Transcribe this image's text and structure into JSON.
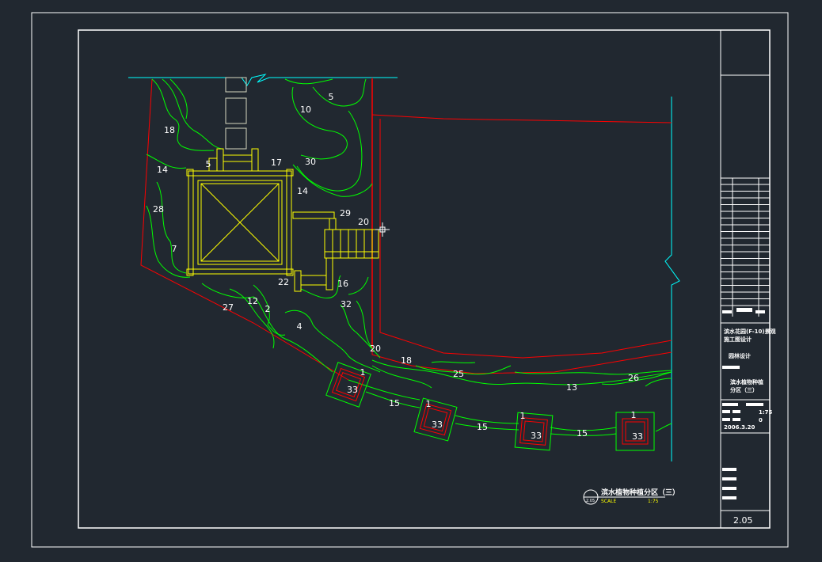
{
  "title_block": {
    "project_name_line1": "滨水花园(F-10)景观",
    "project_name_line2": "施工图设计",
    "discipline": "园林设计",
    "drawing_title_line1": "滨水植物种植",
    "drawing_title_line2": "分区（三）",
    "scale_value": "1:75",
    "revision": "0",
    "date": "2006.3.20",
    "sheet_number": "2.05"
  },
  "drawing_caption": {
    "title": "滨水植物种植分区（三）",
    "ref": "2.05",
    "scale_word": "SCALE",
    "scale_value": "1:75"
  },
  "zones": [
    "5",
    "10",
    "18",
    "14",
    "5",
    "17",
    "30",
    "14",
    "28",
    "29",
    "20",
    "7",
    "22",
    "16",
    "27",
    "12",
    "2",
    "32",
    "4",
    "20",
    "18",
    "25",
    "13",
    "26",
    "1",
    "33",
    "15",
    "1",
    "33",
    "15",
    "1",
    "33",
    "15",
    "1",
    "33"
  ],
  "colors": {
    "background": "#212830",
    "frame": "#ffffff",
    "planting": "#00ff00",
    "building": "#ffff00",
    "boundary": "#ff0000",
    "water_edge": "#00ffff"
  }
}
